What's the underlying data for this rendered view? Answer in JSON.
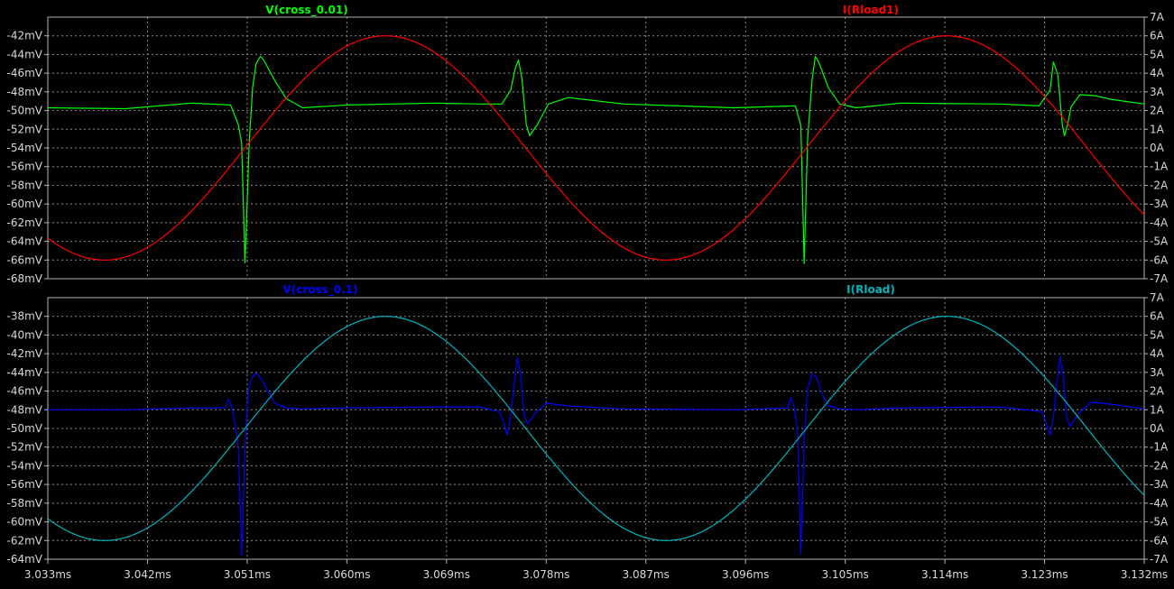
{
  "chart_data": [
    {
      "type": "line",
      "title": "",
      "x_unit": "ms",
      "xlim": [
        3.033,
        3.132
      ],
      "x_ticks": [
        3.033,
        3.042,
        3.051,
        3.06,
        3.069,
        3.078,
        3.087,
        3.096,
        3.105,
        3.114,
        3.123,
        3.132
      ],
      "x_tick_labels": [
        "3.033ms",
        "3.042ms",
        "3.051ms",
        "3.060ms",
        "3.069ms",
        "3.078ms",
        "3.087ms",
        "3.096ms",
        "3.105ms",
        "3.114ms",
        "3.123ms",
        "3.132ms"
      ],
      "left_axis": {
        "unit": "mV",
        "ylim": [
          -68,
          -40
        ],
        "tick_labels": [
          "-42mV",
          "-44mV",
          "-46mV",
          "-48mV",
          "-50mV",
          "-52mV",
          "-54mV",
          "-56mV",
          "-58mV",
          "-60mV",
          "-62mV",
          "-64mV",
          "-66mV",
          "-68mV"
        ],
        "tick_values": [
          -42,
          -44,
          -46,
          -48,
          -50,
          -52,
          -54,
          -56,
          -58,
          -60,
          -62,
          -64,
          -66,
          -68
        ]
      },
      "right_axis": {
        "unit": "A",
        "ylim": [
          -7,
          7
        ],
        "tick_labels": [
          "7A",
          "6A",
          "5A",
          "4A",
          "3A",
          "2A",
          "1A",
          "0A",
          "-1A",
          "-2A",
          "-3A",
          "-4A",
          "-5A",
          "-6A",
          "-7A"
        ],
        "tick_values": [
          7,
          6,
          5,
          4,
          3,
          2,
          1,
          0,
          -1,
          -2,
          -3,
          -4,
          -5,
          -6,
          -7
        ]
      },
      "series": [
        {
          "name": "V(cross_0.01)",
          "axis": "left",
          "color": "#00ff00",
          "x": [
            3.033,
            3.04,
            3.046,
            3.0495,
            3.0502,
            3.0505,
            3.0508,
            3.0512,
            3.0515,
            3.0518,
            3.0522,
            3.0525,
            3.0535,
            3.0545,
            3.056,
            3.06,
            3.068,
            3.072,
            3.074,
            3.0748,
            3.0752,
            3.0755,
            3.0758,
            3.0762,
            3.0765,
            3.0772,
            3.0782,
            3.08,
            3.085,
            3.095,
            3.1005,
            3.101,
            3.1013,
            3.1016,
            3.102,
            3.1023,
            3.1026,
            3.1035,
            3.1045,
            3.106,
            3.11,
            3.119,
            3.1225,
            3.1235,
            3.1238,
            3.1242,
            3.1246,
            3.1248,
            3.1251,
            3.1254,
            3.1262,
            3.1275,
            3.129,
            3.132
          ],
          "y": [
            -49.7,
            -49.8,
            -49.2,
            -49.4,
            -51.5,
            -53.5,
            -66.3,
            -53.0,
            -47.5,
            -45.0,
            -44.2,
            -44.6,
            -46.8,
            -48.7,
            -49.7,
            -49.4,
            -49.2,
            -49.3,
            -49.3,
            -47.8,
            -45.5,
            -44.6,
            -46.5,
            -51.5,
            -52.7,
            -51.5,
            -49.3,
            -48.6,
            -49.3,
            -49.7,
            -49.5,
            -51.6,
            -66.4,
            -53.2,
            -46.8,
            -44.2,
            -44.8,
            -47.6,
            -49.3,
            -49.7,
            -49.2,
            -49.3,
            -49.5,
            -47.8,
            -44.8,
            -46.2,
            -51.5,
            -52.7,
            -51.4,
            -49.6,
            -48.3,
            -48.4,
            -48.8,
            -49.3
          ]
        },
        {
          "name": "I(Rload1)",
          "axis": "right",
          "color": "#ff0000",
          "sine": {
            "amplitude": 6.0,
            "period_ms": 0.0507,
            "phase_ms": 3.0508,
            "offset": 0
          },
          "x": [
            3.033,
            3.132
          ]
        }
      ]
    },
    {
      "type": "line",
      "title": "",
      "x_unit": "ms",
      "xlim": [
        3.033,
        3.132
      ],
      "x_ticks": [
        3.033,
        3.042,
        3.051,
        3.06,
        3.069,
        3.078,
        3.087,
        3.096,
        3.105,
        3.114,
        3.123,
        3.132
      ],
      "x_tick_labels": [
        "3.033ms",
        "3.042ms",
        "3.051ms",
        "3.060ms",
        "3.069ms",
        "3.078ms",
        "3.087ms",
        "3.096ms",
        "3.105ms",
        "3.114ms",
        "3.123ms",
        "3.132ms"
      ],
      "left_axis": {
        "unit": "mV",
        "ylim": [
          -64,
          -36
        ],
        "tick_labels": [
          "-38mV",
          "-40mV",
          "-42mV",
          "-44mV",
          "-46mV",
          "-48mV",
          "-50mV",
          "-52mV",
          "-54mV",
          "-56mV",
          "-58mV",
          "-60mV",
          "-62mV",
          "-64mV"
        ],
        "tick_values": [
          -38,
          -40,
          -42,
          -44,
          -46,
          -48,
          -50,
          -52,
          -54,
          -56,
          -58,
          -60,
          -62,
          -64
        ]
      },
      "right_axis": {
        "unit": "A",
        "ylim": [
          -7,
          7
        ],
        "tick_labels": [
          "7A",
          "6A",
          "5A",
          "4A",
          "3A",
          "2A",
          "1A",
          "0A",
          "-1A",
          "-2A",
          "-3A",
          "-4A",
          "-5A",
          "-6A",
          "-7A"
        ],
        "tick_values": [
          7,
          6,
          5,
          4,
          3,
          2,
          1,
          0,
          -1,
          -2,
          -3,
          -4,
          -5,
          -6,
          -7
        ]
      },
      "series": [
        {
          "name": "V(cross_0.1)",
          "axis": "left",
          "color": "#0000ff",
          "x": [
            3.033,
            3.04,
            3.046,
            3.049,
            3.0493,
            3.0496,
            3.0499,
            3.0502,
            3.0505,
            3.0508,
            3.0511,
            3.0514,
            3.0518,
            3.0521,
            3.0525,
            3.0535,
            3.0545,
            3.056,
            3.06,
            3.068,
            3.072,
            3.0738,
            3.0742,
            3.0745,
            3.0748,
            3.0751,
            3.0754,
            3.0757,
            3.076,
            3.0763,
            3.077,
            3.078,
            3.08,
            3.085,
            3.095,
            3.0998,
            3.1001,
            3.1004,
            3.1007,
            3.101,
            3.1013,
            3.1016,
            3.102,
            3.1024,
            3.1028,
            3.1035,
            3.1045,
            3.106,
            3.11,
            3.119,
            3.1228,
            3.1232,
            3.1235,
            3.1238,
            3.1241,
            3.1244,
            3.1247,
            3.125,
            3.1253,
            3.126,
            3.1272,
            3.129,
            3.132
          ],
          "y": [
            -48.0,
            -48.0,
            -47.8,
            -47.8,
            -46.9,
            -47.6,
            -49.5,
            -52.0,
            -63.6,
            -52.0,
            -46.0,
            -44.6,
            -44.1,
            -44.4,
            -45.2,
            -47.3,
            -47.8,
            -47.9,
            -47.8,
            -47.7,
            -47.7,
            -48.2,
            -49.5,
            -50.7,
            -48.5,
            -45.3,
            -42.4,
            -44.3,
            -48.5,
            -49.5,
            -48.4,
            -47.3,
            -47.6,
            -47.9,
            -48.0,
            -47.8,
            -46.7,
            -47.7,
            -50.5,
            -63.4,
            -51.0,
            -45.8,
            -44.2,
            -44.5,
            -46.0,
            -47.6,
            -47.9,
            -48.0,
            -47.8,
            -47.7,
            -48.2,
            -49.7,
            -50.7,
            -48.8,
            -45.4,
            -42.3,
            -44.5,
            -48.8,
            -49.8,
            -48.5,
            -47.2,
            -47.4,
            -47.9
          ]
        },
        {
          "name": "I(Rload)",
          "axis": "right",
          "color": "#00b4be",
          "sine": {
            "amplitude": 6.0,
            "period_ms": 0.0507,
            "phase_ms": 3.0508,
            "offset": 0
          },
          "x": [
            3.033,
            3.132
          ]
        }
      ]
    }
  ],
  "colors": {
    "background": "#000000",
    "grid": "#8c8c8c",
    "frame": "#b4b4b4",
    "text": "#d8d8d8"
  }
}
